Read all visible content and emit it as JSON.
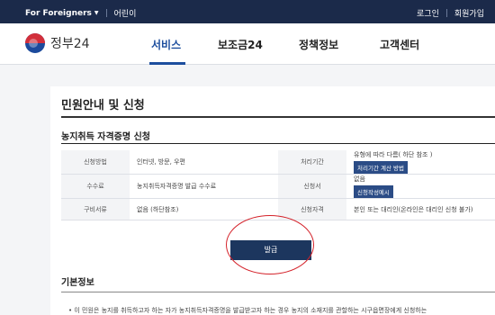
{
  "topbar": {
    "foreigners": "For Foreigners",
    "kids": "어린이",
    "login": "로그인",
    "signup": "회원가입"
  },
  "header": {
    "logo": "정부24",
    "nav": [
      "서비스",
      "보조금24",
      "정책정보",
      "고객센터"
    ]
  },
  "main": {
    "page_title": "민원안내 및 신청",
    "subtitle": "농지취득 자격증명 신청",
    "rows": [
      {
        "l1": "신청방법",
        "v1": "인터넷, 방문, 우편",
        "l2": "처리기간",
        "v2": "유형에 따라 다름( 하단 참조 )",
        "btn2": "처리기간 계산 방법"
      },
      {
        "l1": "수수료",
        "v1": "농지취득자격증명 발급 수수료",
        "l2": "신청서",
        "v2": "없음",
        "btn2": "신청작성예시"
      },
      {
        "l1": "구비서류",
        "v1": "없음 (하단참조)",
        "l2": "신청자격",
        "v2": "본인 또는 대리인(온라인은 대리인 신청 불가)"
      }
    ],
    "issue_button": "발급",
    "section_title": "기본정보",
    "bullet": "이 민원은 농지를 취득하고자 하는 자가 농지취득자격증명을 발급받고자 하는 경우 농지의 소재지를 관할하는 시구읍면장에게 신청하는"
  },
  "colors": {
    "navy": "#1b2a4a",
    "accent": "#1d4e9e",
    "highlight_circle": "#d4222a"
  }
}
